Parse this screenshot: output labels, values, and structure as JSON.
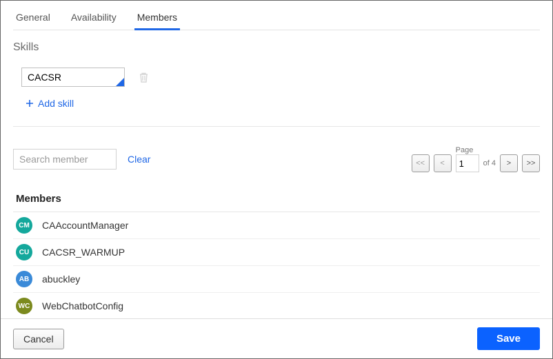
{
  "tabs": {
    "general": "General",
    "availability": "Availability",
    "members": "Members"
  },
  "skills": {
    "title": "Skills",
    "value": "CACSR",
    "add_label": "Add skill"
  },
  "search": {
    "placeholder": "Search member",
    "clear": "Clear"
  },
  "pagination": {
    "first": "<<",
    "prev": "<",
    "page_label": "Page",
    "page_value": "1",
    "of_label": "of 4",
    "next": ">",
    "last": ">>"
  },
  "members": {
    "title": "Members",
    "rows": [
      {
        "initials": "CM",
        "name": "CAAccountManager",
        "color": "teal"
      },
      {
        "initials": "CU",
        "name": "CACSR_WARMUP",
        "color": "teal"
      },
      {
        "initials": "AB",
        "name": "abuckley",
        "color": "blue"
      },
      {
        "initials": "WC",
        "name": "WebChatbotConfig",
        "color": "olive"
      }
    ]
  },
  "footer": {
    "cancel": "Cancel",
    "save": "Save"
  }
}
